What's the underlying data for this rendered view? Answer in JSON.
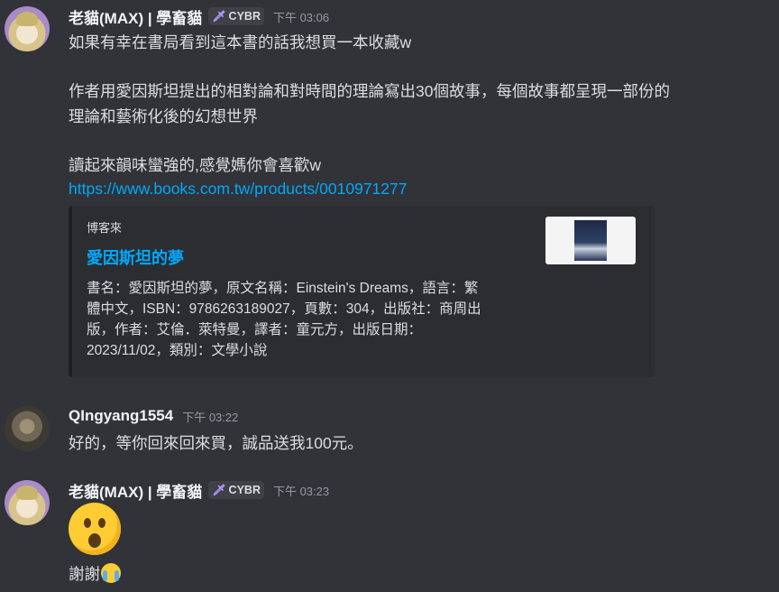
{
  "messages": [
    {
      "username": "老貓(MAX) | 學畜貓",
      "tag": "CYBR",
      "time": "下午 03:06",
      "lines": [
        "如果有幸在書局看到這本書的話我想買一本收藏w",
        "作者用愛因斯坦提出的相對論和對時間的理論寫出30個故事，每個故事都呈現一部份的",
        "理論和藝術化後的幻想世界",
        "讀起來韻味蠻強的,感覺媽你會喜歡w"
      ],
      "link": "https://www.books.com.tw/products/0010971277",
      "embed": {
        "provider": "博客來",
        "title": "愛因斯坦的夢",
        "description_lines": [
          "書名：愛因斯坦的夢，原文名稱：Einstein's Dreams，語言：繁",
          "體中文，ISBN：9786263189027，頁數：304，出版社：商周出",
          "版，作者：艾倫．萊特曼，譯者：童元方，出版日期：",
          "2023/11/02，類別：文學小說"
        ]
      }
    },
    {
      "username": "QIngyang1554",
      "time": "下午 03:22",
      "lines": [
        "好的，等你回來回來買，誠品送我100元。"
      ]
    },
    {
      "username": "老貓(MAX) | 學畜貓",
      "tag": "CYBR",
      "time": "下午 03:23",
      "emoji": "hushed-face",
      "lines": [
        "謝謝"
      ],
      "inline_emoji": "sob"
    }
  ]
}
